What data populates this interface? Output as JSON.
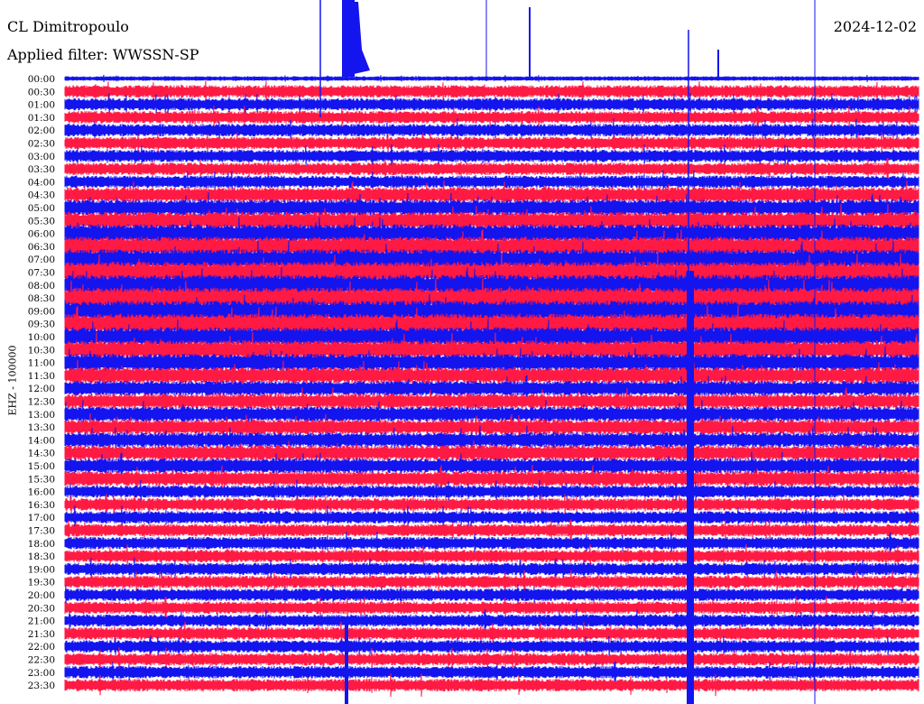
{
  "header": {
    "station": "CL Dimitropoulo",
    "filter": "Applied filter: WWSSN-SP",
    "date": "2024-12-02"
  },
  "chart_data": {
    "type": "line",
    "title": "CL Dimitropoulo",
    "subtitle": "Applied filter: WWSSN-SP",
    "date": "2024-12-02",
    "ylabel": "EHZ - 100000",
    "rows": [
      "00:00",
      "00:30",
      "01:00",
      "01:30",
      "02:00",
      "02:30",
      "03:00",
      "03:30",
      "04:00",
      "04:30",
      "05:00",
      "05:30",
      "06:00",
      "06:30",
      "07:00",
      "07:30",
      "08:00",
      "08:30",
      "09:00",
      "09:30",
      "10:00",
      "10:30",
      "11:00",
      "11:30",
      "12:00",
      "12:30",
      "13:00",
      "13:30",
      "14:00",
      "14:30",
      "15:00",
      "15:30",
      "16:00",
      "16:30",
      "17:00",
      "17:30",
      "18:00",
      "18:30",
      "19:00",
      "19:30",
      "20:00",
      "20:30",
      "21:00",
      "21:30",
      "22:00",
      "22:30",
      "23:00",
      "23:30"
    ],
    "colors": [
      "#1414ee",
      "#ff1a44"
    ],
    "grid": false,
    "legend": "none"
  }
}
